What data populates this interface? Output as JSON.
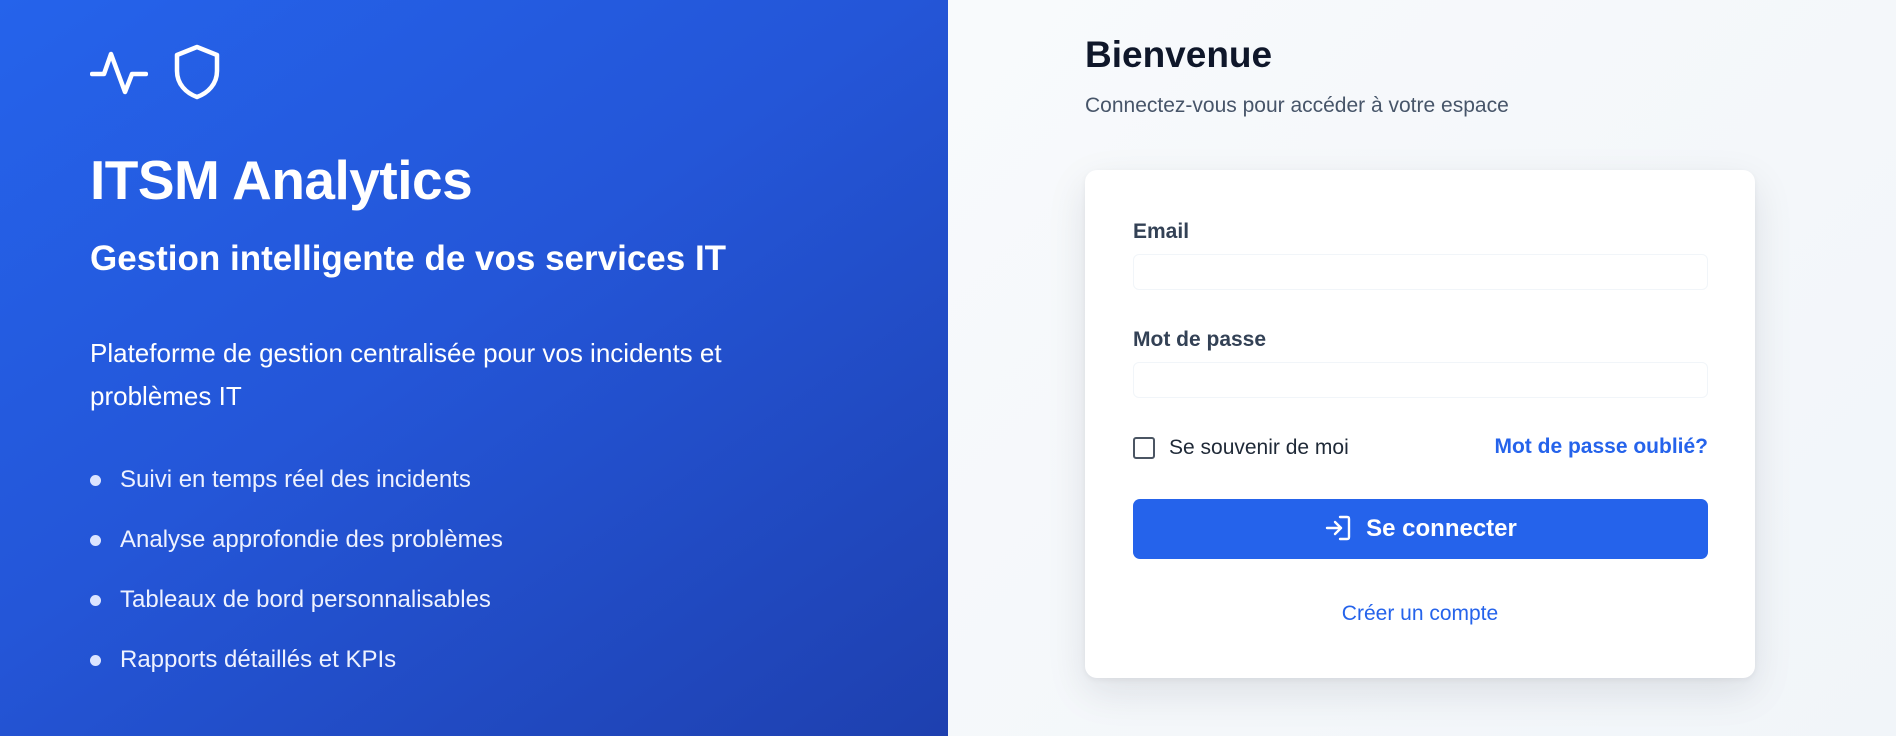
{
  "hero": {
    "icons": [
      "activity-icon",
      "shield-icon"
    ],
    "title": "ITSM Analytics",
    "subtitle": "Gestion intelligente de vos services IT",
    "description": "Plateforme de gestion centralisée pour vos incidents et problèmes IT",
    "features": [
      "Suivi en temps réel des incidents",
      "Analyse approfondie des problèmes",
      "Tableaux de bord personnalisables",
      "Rapports détaillés et KPIs"
    ]
  },
  "login": {
    "title": "Bienvenue",
    "subtitle": "Connectez-vous pour accéder à votre espace",
    "email": {
      "label": "Email",
      "value": "",
      "placeholder": ""
    },
    "password": {
      "label": "Mot de passe",
      "value": "",
      "placeholder": ""
    },
    "remember_label": "Se souvenir de moi",
    "remember_checked": false,
    "forgot_label": "Mot de passe oublié?",
    "submit_label": "Se connecter",
    "submit_icon": "log-in-icon",
    "create_account_label": "Créer un compte"
  },
  "colors": {
    "accent": "#2563eb",
    "hero_gradient_start": "#2563eb",
    "hero_gradient_end": "#1e40af",
    "background": "#f8fafc"
  }
}
